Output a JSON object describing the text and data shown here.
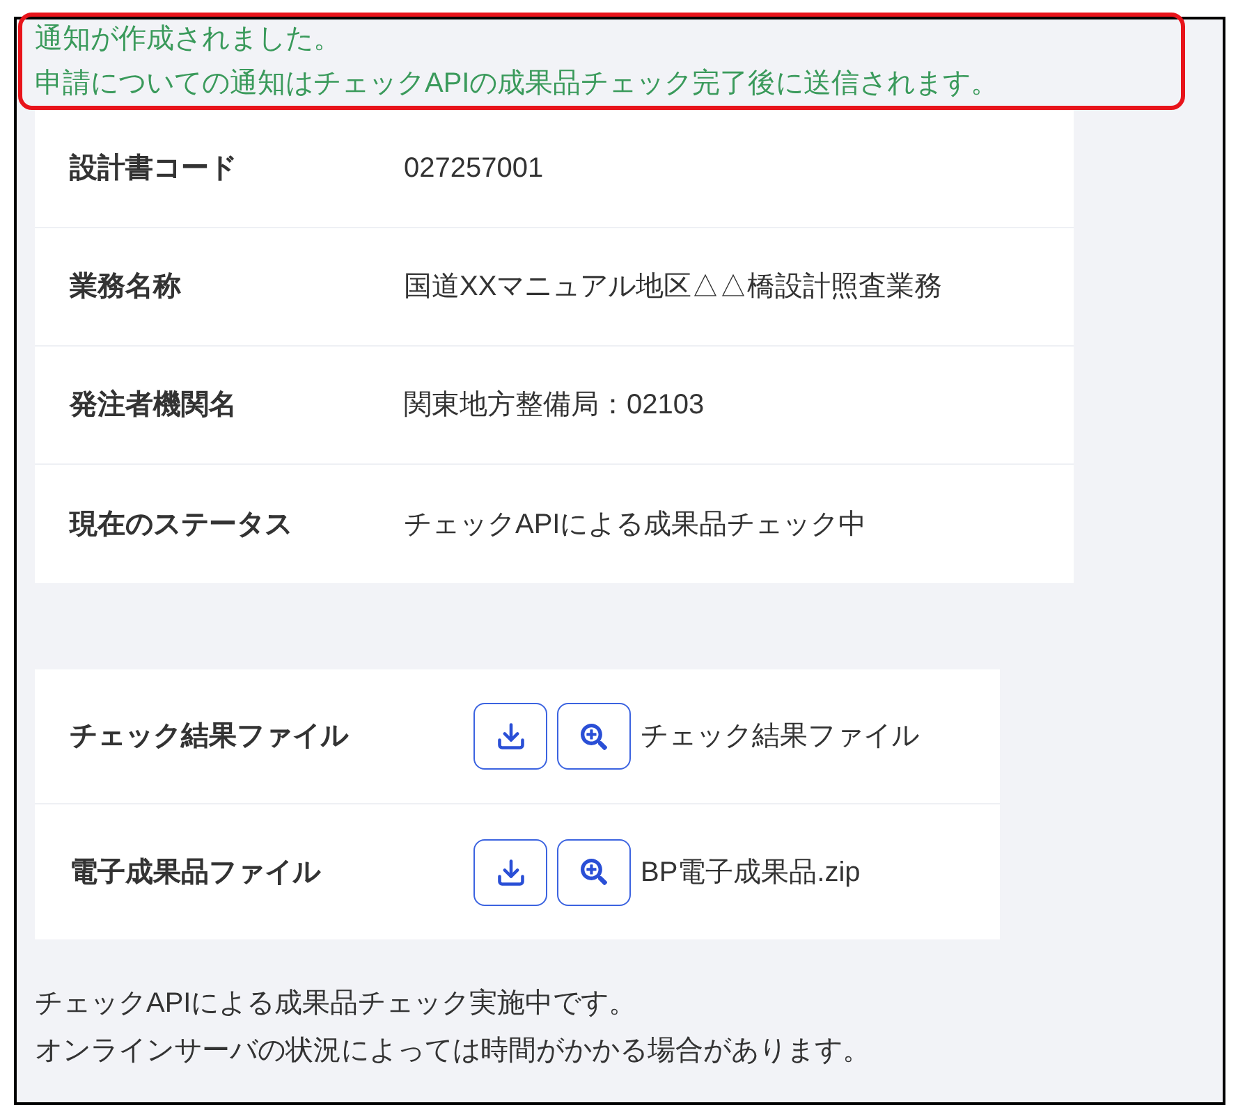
{
  "notice": {
    "lines": [
      "通知が作成されました。",
      "申請についての通知はチェックAPIの成果品チェック完了後に送信されます。"
    ]
  },
  "details": [
    {
      "label": "設計書コード",
      "value": "027257001"
    },
    {
      "label": "業務名称",
      "value": "国道XXマニュアル地区△△橋設計照査業務"
    },
    {
      "label": "発注者機関名",
      "value": "関東地方整備局：02103"
    },
    {
      "label": "現在のステータス",
      "value": "チェックAPIによる成果品チェック中"
    }
  ],
  "files": [
    {
      "label": "チェック結果ファイル",
      "file_name": "チェック結果ファイル"
    },
    {
      "label": "電子成果品ファイル",
      "file_name": "BP電子成果品.zip"
    }
  ],
  "footer_lines": [
    "チェックAPIによる成果品チェック実施中です。",
    "オンラインサーバの状況によっては時間がかかる場合があります。"
  ]
}
